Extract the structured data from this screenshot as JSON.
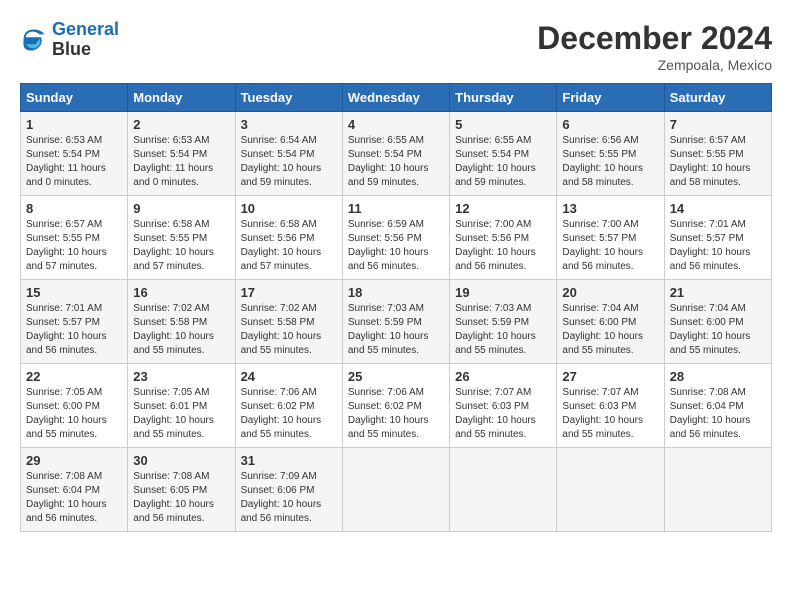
{
  "header": {
    "logo_line1": "General",
    "logo_line2": "Blue",
    "month_title": "December 2024",
    "location": "Zempoala, Mexico"
  },
  "weekdays": [
    "Sunday",
    "Monday",
    "Tuesday",
    "Wednesday",
    "Thursday",
    "Friday",
    "Saturday"
  ],
  "weeks": [
    [
      {
        "day": "1",
        "sunrise": "6:53 AM",
        "sunset": "5:54 PM",
        "daylight": "11 hours and 0 minutes."
      },
      {
        "day": "2",
        "sunrise": "6:53 AM",
        "sunset": "5:54 PM",
        "daylight": "11 hours and 0 minutes."
      },
      {
        "day": "3",
        "sunrise": "6:54 AM",
        "sunset": "5:54 PM",
        "daylight": "10 hours and 59 minutes."
      },
      {
        "day": "4",
        "sunrise": "6:55 AM",
        "sunset": "5:54 PM",
        "daylight": "10 hours and 59 minutes."
      },
      {
        "day": "5",
        "sunrise": "6:55 AM",
        "sunset": "5:54 PM",
        "daylight": "10 hours and 59 minutes."
      },
      {
        "day": "6",
        "sunrise": "6:56 AM",
        "sunset": "5:55 PM",
        "daylight": "10 hours and 58 minutes."
      },
      {
        "day": "7",
        "sunrise": "6:57 AM",
        "sunset": "5:55 PM",
        "daylight": "10 hours and 58 minutes."
      }
    ],
    [
      {
        "day": "8",
        "sunrise": "6:57 AM",
        "sunset": "5:55 PM",
        "daylight": "10 hours and 57 minutes."
      },
      {
        "day": "9",
        "sunrise": "6:58 AM",
        "sunset": "5:55 PM",
        "daylight": "10 hours and 57 minutes."
      },
      {
        "day": "10",
        "sunrise": "6:58 AM",
        "sunset": "5:56 PM",
        "daylight": "10 hours and 57 minutes."
      },
      {
        "day": "11",
        "sunrise": "6:59 AM",
        "sunset": "5:56 PM",
        "daylight": "10 hours and 56 minutes."
      },
      {
        "day": "12",
        "sunrise": "7:00 AM",
        "sunset": "5:56 PM",
        "daylight": "10 hours and 56 minutes."
      },
      {
        "day": "13",
        "sunrise": "7:00 AM",
        "sunset": "5:57 PM",
        "daylight": "10 hours and 56 minutes."
      },
      {
        "day": "14",
        "sunrise": "7:01 AM",
        "sunset": "5:57 PM",
        "daylight": "10 hours and 56 minutes."
      }
    ],
    [
      {
        "day": "15",
        "sunrise": "7:01 AM",
        "sunset": "5:57 PM",
        "daylight": "10 hours and 56 minutes."
      },
      {
        "day": "16",
        "sunrise": "7:02 AM",
        "sunset": "5:58 PM",
        "daylight": "10 hours and 55 minutes."
      },
      {
        "day": "17",
        "sunrise": "7:02 AM",
        "sunset": "5:58 PM",
        "daylight": "10 hours and 55 minutes."
      },
      {
        "day": "18",
        "sunrise": "7:03 AM",
        "sunset": "5:59 PM",
        "daylight": "10 hours and 55 minutes."
      },
      {
        "day": "19",
        "sunrise": "7:03 AM",
        "sunset": "5:59 PM",
        "daylight": "10 hours and 55 minutes."
      },
      {
        "day": "20",
        "sunrise": "7:04 AM",
        "sunset": "6:00 PM",
        "daylight": "10 hours and 55 minutes."
      },
      {
        "day": "21",
        "sunrise": "7:04 AM",
        "sunset": "6:00 PM",
        "daylight": "10 hours and 55 minutes."
      }
    ],
    [
      {
        "day": "22",
        "sunrise": "7:05 AM",
        "sunset": "6:00 PM",
        "daylight": "10 hours and 55 minutes."
      },
      {
        "day": "23",
        "sunrise": "7:05 AM",
        "sunset": "6:01 PM",
        "daylight": "10 hours and 55 minutes."
      },
      {
        "day": "24",
        "sunrise": "7:06 AM",
        "sunset": "6:02 PM",
        "daylight": "10 hours and 55 minutes."
      },
      {
        "day": "25",
        "sunrise": "7:06 AM",
        "sunset": "6:02 PM",
        "daylight": "10 hours and 55 minutes."
      },
      {
        "day": "26",
        "sunrise": "7:07 AM",
        "sunset": "6:03 PM",
        "daylight": "10 hours and 55 minutes."
      },
      {
        "day": "27",
        "sunrise": "7:07 AM",
        "sunset": "6:03 PM",
        "daylight": "10 hours and 55 minutes."
      },
      {
        "day": "28",
        "sunrise": "7:08 AM",
        "sunset": "6:04 PM",
        "daylight": "10 hours and 56 minutes."
      }
    ],
    [
      {
        "day": "29",
        "sunrise": "7:08 AM",
        "sunset": "6:04 PM",
        "daylight": "10 hours and 56 minutes."
      },
      {
        "day": "30",
        "sunrise": "7:08 AM",
        "sunset": "6:05 PM",
        "daylight": "10 hours and 56 minutes."
      },
      {
        "day": "31",
        "sunrise": "7:09 AM",
        "sunset": "6:06 PM",
        "daylight": "10 hours and 56 minutes."
      },
      null,
      null,
      null,
      null
    ]
  ]
}
